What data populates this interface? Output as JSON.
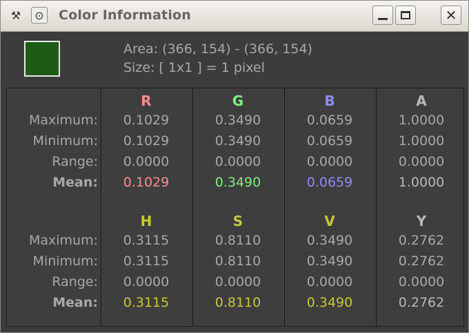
{
  "window": {
    "title": "Color Information"
  },
  "titlebar_icons": {
    "app": "tools-icon",
    "menu": "window-menu-icon",
    "minimize": "minimize-icon",
    "maximize": "maximize-icon",
    "close": "close-icon"
  },
  "swatch_color": "#1d5b16",
  "area_text": "Area: (366, 154) - (366, 154)",
  "size_text": "Size: [ 1x1 ] = 1 pixel",
  "row_labels": {
    "maximum": "Maximum:",
    "minimum": "Minimum:",
    "range": "Range:",
    "mean": "Mean:"
  },
  "colors": {
    "R": "#ff8b8b",
    "G": "#7df07d",
    "B": "#8c8cf0",
    "A": "#b8b8b8",
    "HSV": "#c8c83a",
    "Y": "#b8b8b8",
    "text": "#a8a8a8"
  },
  "rgba": {
    "headers": [
      "R",
      "G",
      "B",
      "A"
    ],
    "maximum": [
      "0.1029",
      "0.3490",
      "0.0659",
      "1.0000"
    ],
    "minimum": [
      "0.1029",
      "0.3490",
      "0.0659",
      "1.0000"
    ],
    "range": [
      "0.0000",
      "0.0000",
      "0.0000",
      "0.0000"
    ],
    "mean": [
      "0.1029",
      "0.3490",
      "0.0659",
      "1.0000"
    ]
  },
  "hsvy": {
    "headers": [
      "H",
      "S",
      "V",
      "Y"
    ],
    "maximum": [
      "0.3115",
      "0.8110",
      "0.3490",
      "0.2762"
    ],
    "minimum": [
      "0.3115",
      "0.8110",
      "0.3490",
      "0.2762"
    ],
    "range": [
      "0.0000",
      "0.0000",
      "0.0000",
      "0.0000"
    ],
    "mean": [
      "0.3115",
      "0.8110",
      "0.3490",
      "0.2762"
    ]
  }
}
